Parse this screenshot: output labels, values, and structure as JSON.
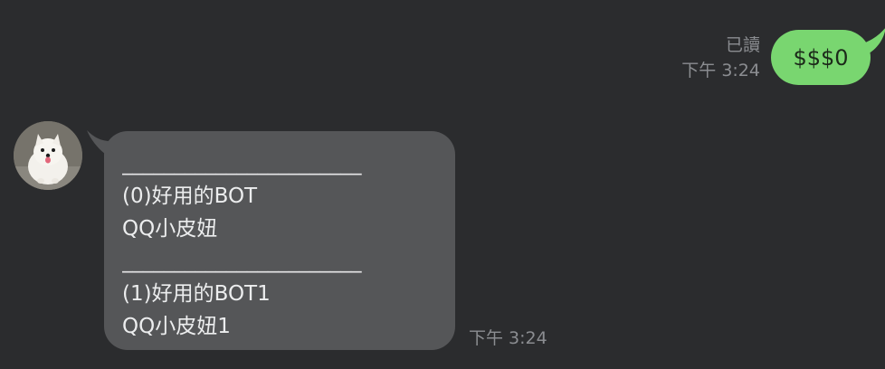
{
  "outgoing": {
    "read_status": "已讀",
    "time": "下午 3:24",
    "text": "$$$0",
    "bubble_color": "#79d670"
  },
  "incoming": {
    "avatar_icon": "pomeranian-dog-avatar",
    "lines": [
      "_______________________",
      "(0)好用的BOT",
      "QQ小皮妞",
      "_______________________",
      "(1)好用的BOT1",
      "QQ小皮妞1"
    ],
    "time": "下午 3:24",
    "bubble_color": "#555658"
  },
  "background_color": "#2b2c2e"
}
